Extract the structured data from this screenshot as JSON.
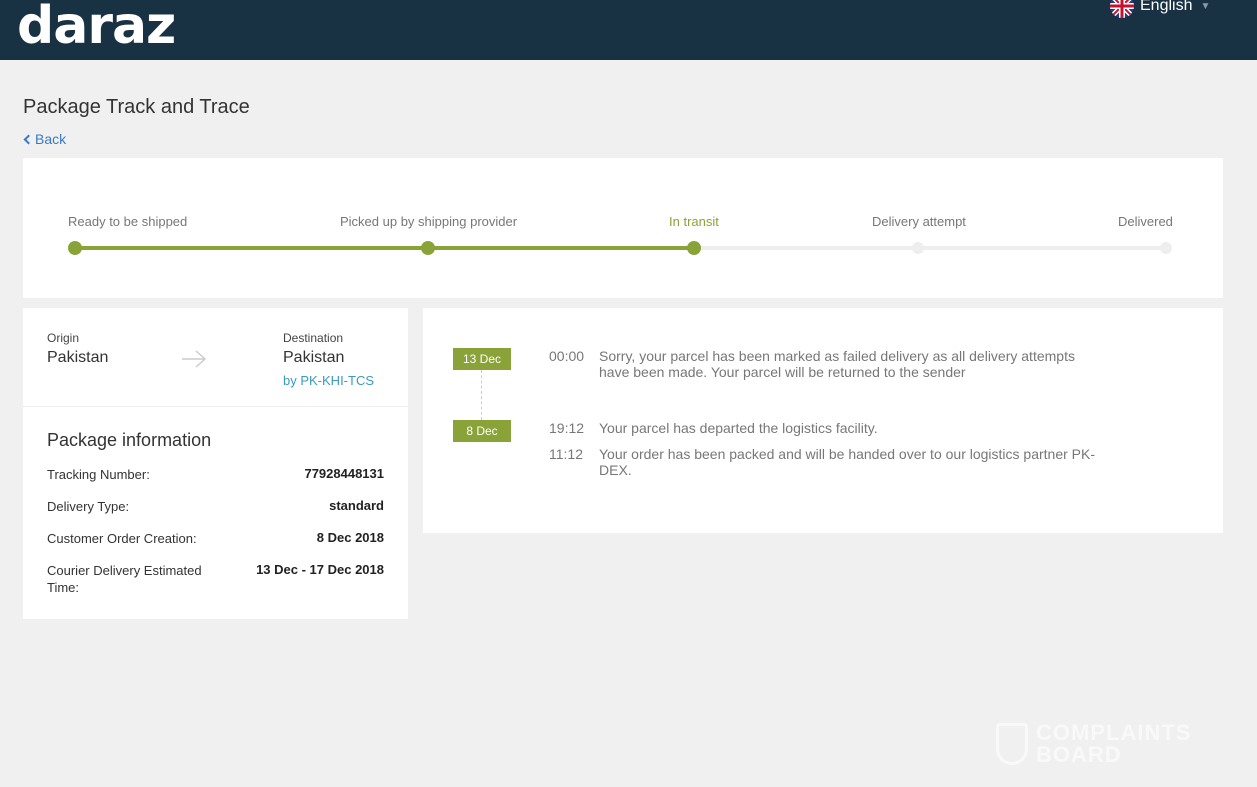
{
  "header": {
    "logo": "daraz",
    "language": "English",
    "flag_icon": "uk-flag-icon",
    "background_color": "#183244"
  },
  "page": {
    "title": "Package Track and Trace",
    "back_label": "Back"
  },
  "progress": {
    "steps": [
      {
        "label": "Ready to be shipped",
        "state": "done"
      },
      {
        "label": "Picked up by shipping provider",
        "state": "done"
      },
      {
        "label": "In transit",
        "state": "current"
      },
      {
        "label": "Delivery attempt",
        "state": "pending"
      },
      {
        "label": "Delivered",
        "state": "pending"
      }
    ],
    "accent_color": "#8aa338"
  },
  "route": {
    "origin_label": "Origin",
    "origin": "Pakistan",
    "destination_label": "Destination",
    "destination": "Pakistan",
    "carrier": "by PK-KHI-TCS"
  },
  "package_info": {
    "title": "Package information",
    "rows": [
      {
        "label": "Tracking Number:",
        "value": "77928448131"
      },
      {
        "label": "Delivery Type:",
        "value": "standard"
      },
      {
        "label": "Customer Order Creation:",
        "value": "8 Dec 2018"
      },
      {
        "label": "Courier Delivery Estimated Time:",
        "value": "13 Dec - 17 Dec 2018"
      }
    ]
  },
  "timeline": {
    "groups": [
      {
        "date": "13 Dec",
        "events": [
          {
            "time": "00:00",
            "text": "Sorry, your parcel has been marked as failed delivery as all delivery attempts have been made. Your parcel will be returned to the sender"
          }
        ]
      },
      {
        "date": "8 Dec",
        "events": [
          {
            "time": "19:12",
            "text": "Your parcel has departed the logistics facility."
          },
          {
            "time": "11:12",
            "text": "Your order has been packed and will be handed over to our logistics partner PK-DEX."
          }
        ]
      }
    ]
  },
  "watermark": {
    "line1": "COMPLAINTS",
    "line2": "BOARD"
  }
}
